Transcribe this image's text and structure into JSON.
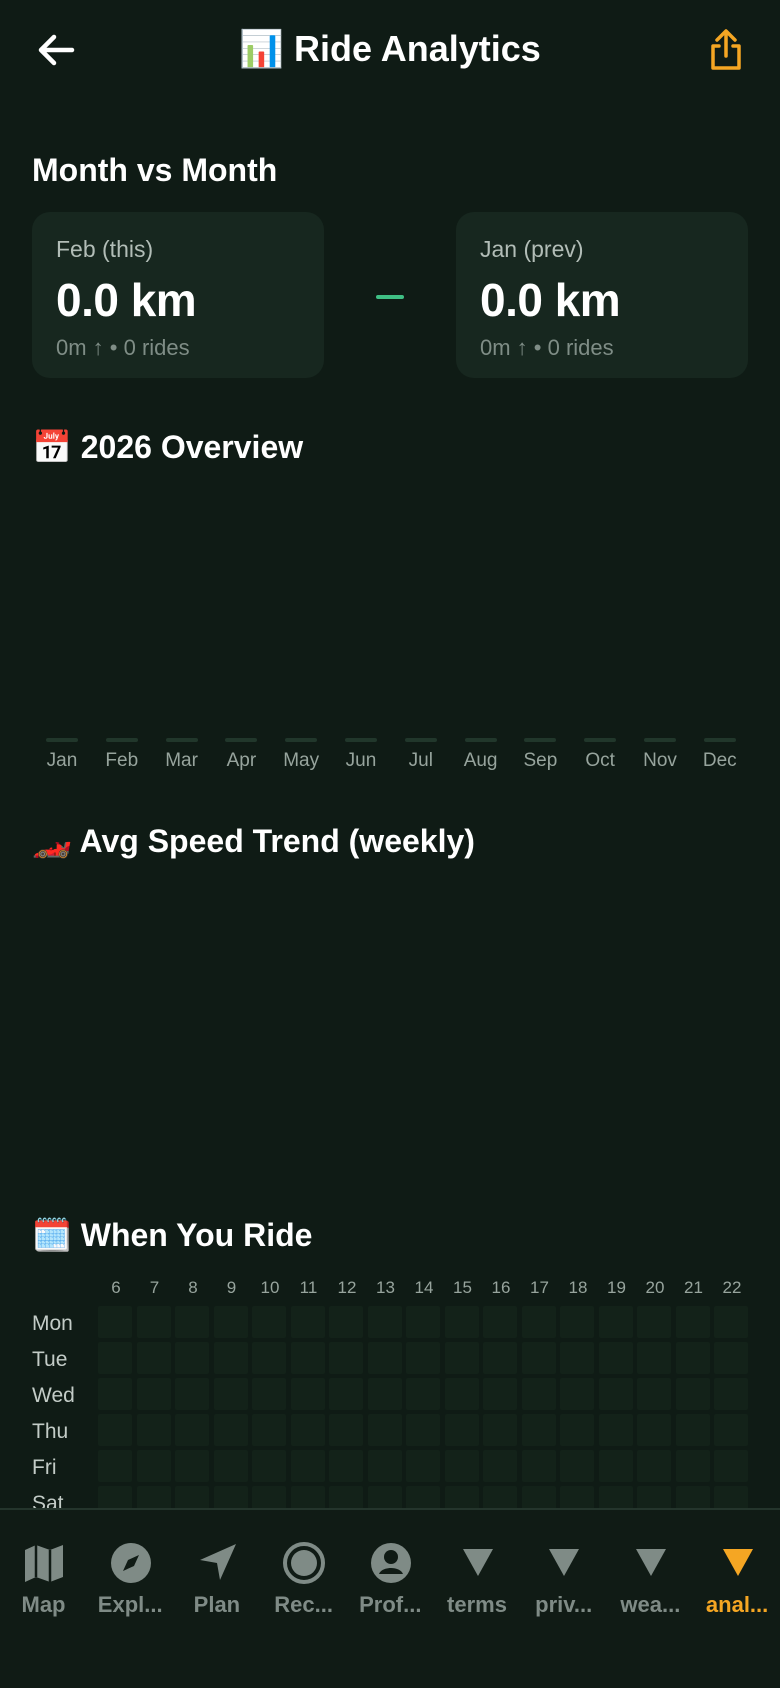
{
  "header": {
    "title": "📊 Ride Analytics",
    "back_icon": "back-arrow-icon",
    "share_icon": "share-icon"
  },
  "colors": {
    "background": "#0f1b15",
    "card": "#17271f",
    "accent_green": "#3fbf84",
    "accent_orange": "#f5a623",
    "nav_inactive": "#7f8b86"
  },
  "month_vs_month": {
    "title": "Month vs Month",
    "current": {
      "label": "Feb (this)",
      "distance": "0.0 km",
      "details": "0m ↑ • 0 rides"
    },
    "previous": {
      "label": "Jan (prev)",
      "distance": "0.0 km",
      "details": "0m ↑ • 0 rides"
    }
  },
  "overview": {
    "title": "📅 2026 Overview",
    "chart_data": {
      "type": "bar",
      "categories": [
        "Jan",
        "Feb",
        "Mar",
        "Apr",
        "May",
        "Jun",
        "Jul",
        "Aug",
        "Sep",
        "Oct",
        "Nov",
        "Dec"
      ],
      "values": [
        0,
        0,
        0,
        0,
        0,
        0,
        0,
        0,
        0,
        0,
        0,
        0
      ]
    }
  },
  "speed_trend": {
    "title": "🏎️ Avg Speed Trend (weekly)"
  },
  "when_you_ride": {
    "title": "🗓️ When You Ride",
    "hours": [
      "6",
      "7",
      "8",
      "9",
      "10",
      "11",
      "12",
      "13",
      "14",
      "15",
      "16",
      "17",
      "18",
      "19",
      "20",
      "21",
      "22"
    ],
    "days": [
      "Mon",
      "Tue",
      "Wed",
      "Thu",
      "Fri",
      "Sat"
    ]
  },
  "nav": {
    "items": [
      {
        "label": "Map",
        "icon": "map-icon",
        "active": false
      },
      {
        "label": "Expl...",
        "icon": "compass-icon",
        "active": false
      },
      {
        "label": "Plan",
        "icon": "navigation-arrow-icon",
        "active": false
      },
      {
        "label": "Rec...",
        "icon": "record-icon",
        "active": false
      },
      {
        "label": "Prof...",
        "icon": "profile-icon",
        "active": false
      },
      {
        "label": "terms",
        "icon": "triangle-down-icon",
        "active": false
      },
      {
        "label": "priv...",
        "icon": "triangle-down-icon",
        "active": false
      },
      {
        "label": "wea...",
        "icon": "triangle-down-icon",
        "active": false
      },
      {
        "label": "anal...",
        "icon": "triangle-down-icon",
        "active": true
      }
    ]
  }
}
